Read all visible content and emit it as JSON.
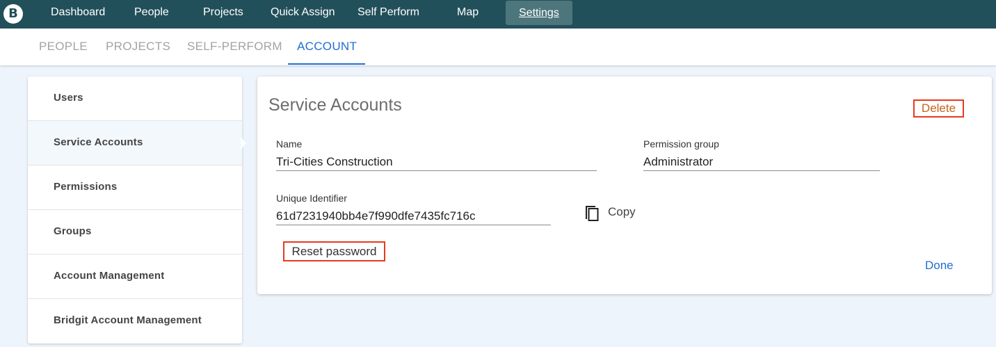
{
  "app": {
    "logo_letter": "B"
  },
  "topnav": {
    "items": [
      {
        "label": "Dashboard"
      },
      {
        "label": "People"
      },
      {
        "label": "Projects"
      },
      {
        "label": "Quick Assign"
      },
      {
        "label": "Self Perform"
      },
      {
        "label": "Map"
      },
      {
        "label": "Settings",
        "active": true
      }
    ]
  },
  "subtabs": {
    "items": [
      {
        "label": "PEOPLE"
      },
      {
        "label": "PROJECTS"
      },
      {
        "label": "SELF-PERFORM"
      },
      {
        "label": "ACCOUNT",
        "active": true
      }
    ]
  },
  "sidemenu": {
    "items": [
      {
        "label": "Users"
      },
      {
        "label": "Service Accounts",
        "selected": true
      },
      {
        "label": "Permissions"
      },
      {
        "label": "Groups"
      },
      {
        "label": "Account Management"
      },
      {
        "label": "Bridgit Account Management"
      }
    ]
  },
  "card": {
    "title": "Service Accounts",
    "delete_label": "Delete",
    "name": {
      "label": "Name",
      "value": "Tri-Cities Construction"
    },
    "permission_group": {
      "label": "Permission group",
      "value": "Administrator"
    },
    "unique_identifier": {
      "label": "Unique Identifier",
      "value": "61d7231940bb4e7f990dfe7435fc716c"
    },
    "copy_label": "Copy",
    "copy_icon": "copy-icon",
    "reset_label": "Reset password",
    "done_label": "Done"
  },
  "colors": {
    "topnav_bg": "#22505a",
    "accent": "#1f6ed4",
    "highlight_border": "#e63a1f",
    "delete_text": "#c7631b"
  }
}
